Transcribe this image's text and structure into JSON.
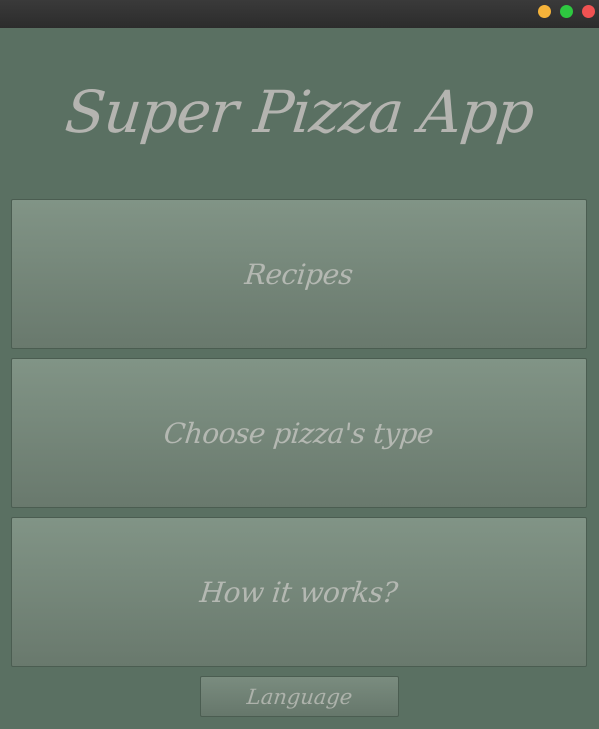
{
  "window": {
    "controls": [
      {
        "name": "minimize",
        "color": "#f5b33a"
      },
      {
        "name": "maximize",
        "color": "#2ec840"
      },
      {
        "name": "close",
        "color": "#f05252"
      }
    ]
  },
  "app": {
    "title": "Super Pizza App"
  },
  "menu": {
    "recipes_label": "Recipes",
    "choose_type_label": "Choose pizza's type",
    "how_it_works_label": "How it works?",
    "language_label": "Language"
  },
  "colors": {
    "background": "#5a7062",
    "button_gradient_top": "#819486",
    "button_gradient_bottom": "#69796d",
    "text": "#b4b4b0"
  }
}
